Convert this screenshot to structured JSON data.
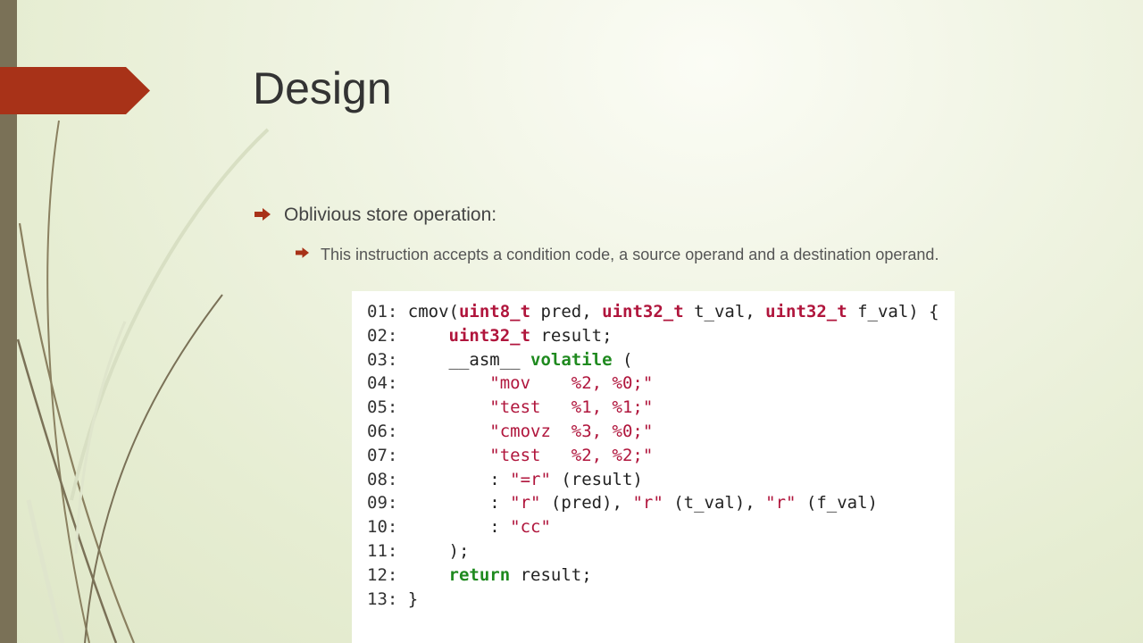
{
  "slide": {
    "title": "Design",
    "bullets": [
      {
        "text": "Oblivious store operation:",
        "sub": [
          {
            "text": "This instruction accepts a condition code, a source operand and a destination operand."
          }
        ]
      }
    ]
  },
  "code": {
    "lines": [
      {
        "num": "01:",
        "segments": [
          {
            "t": "cmov(",
            "s": "p"
          },
          {
            "t": "uint8_t",
            "s": "tp"
          },
          {
            "t": " pred, ",
            "s": "p"
          },
          {
            "t": "uint32_t",
            "s": "tp"
          },
          {
            "t": " t_val, ",
            "s": "p"
          },
          {
            "t": "uint32_t",
            "s": "tp"
          },
          {
            "t": " f_val) {",
            "s": "p"
          }
        ]
      },
      {
        "num": "02:",
        "segments": [
          {
            "t": "    ",
            "s": "p"
          },
          {
            "t": "uint32_t",
            "s": "tp"
          },
          {
            "t": " result;",
            "s": "p"
          }
        ]
      },
      {
        "num": "03:",
        "segments": [
          {
            "t": "    __asm__ ",
            "s": "p"
          },
          {
            "t": "volatile",
            "s": "kw"
          },
          {
            "t": " (",
            "s": "p"
          }
        ]
      },
      {
        "num": "04:",
        "segments": [
          {
            "t": "        ",
            "s": "p"
          },
          {
            "t": "\"mov    %2, %0;\"",
            "s": "st"
          }
        ]
      },
      {
        "num": "05:",
        "segments": [
          {
            "t": "        ",
            "s": "p"
          },
          {
            "t": "\"test   %1, %1;\"",
            "s": "st"
          }
        ]
      },
      {
        "num": "06:",
        "segments": [
          {
            "t": "        ",
            "s": "p"
          },
          {
            "t": "\"cmovz  %3, %0;\"",
            "s": "st"
          }
        ]
      },
      {
        "num": "07:",
        "segments": [
          {
            "t": "        ",
            "s": "p"
          },
          {
            "t": "\"test   %2, %2;\"",
            "s": "st"
          }
        ]
      },
      {
        "num": "08:",
        "segments": [
          {
            "t": "        : ",
            "s": "p"
          },
          {
            "t": "\"=r\"",
            "s": "st"
          },
          {
            "t": " (result)",
            "s": "p"
          }
        ]
      },
      {
        "num": "09:",
        "segments": [
          {
            "t": "        : ",
            "s": "p"
          },
          {
            "t": "\"r\"",
            "s": "st"
          },
          {
            "t": " (pred), ",
            "s": "p"
          },
          {
            "t": "\"r\"",
            "s": "st"
          },
          {
            "t": " (t_val), ",
            "s": "p"
          },
          {
            "t": "\"r\"",
            "s": "st"
          },
          {
            "t": " (f_val)",
            "s": "p"
          }
        ]
      },
      {
        "num": "10:",
        "segments": [
          {
            "t": "        : ",
            "s": "p"
          },
          {
            "t": "\"cc\"",
            "s": "st"
          }
        ]
      },
      {
        "num": "11:",
        "segments": [
          {
            "t": "    );",
            "s": "p"
          }
        ]
      },
      {
        "num": "12:",
        "segments": [
          {
            "t": "    ",
            "s": "p"
          },
          {
            "t": "return",
            "s": "kw"
          },
          {
            "t": " result;",
            "s": "p"
          }
        ]
      },
      {
        "num": "13:",
        "segments": [
          {
            "t": "}",
            "s": "p"
          }
        ]
      }
    ]
  },
  "theme": {
    "accent": "#a83218",
    "sidebar": "#7a7157",
    "type_color": "#b0153c",
    "keyword_color": "#1f8a1f"
  }
}
